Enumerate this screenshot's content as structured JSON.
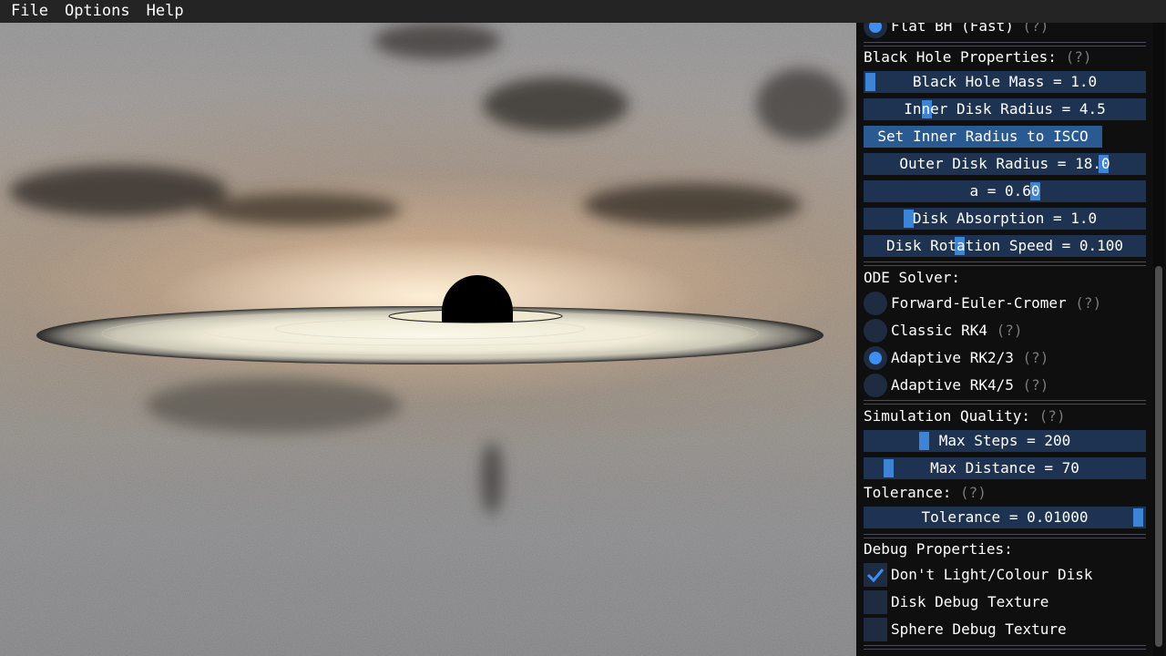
{
  "menu": {
    "file": "File",
    "options": "Options",
    "help": "Help"
  },
  "panel": {
    "flat_bh": {
      "label": "Flat BH (Fast)",
      "help": "(?)",
      "selected": true
    },
    "black_hole": {
      "heading": "Black Hole Properties:",
      "help": "(?)",
      "mass": "Black Hole Mass = 1.0",
      "inner_radius": "Inner Disk Radius = 4.5",
      "set_isco": "Set Inner Radius to ISCO",
      "outer_radius": "Outer Disk Radius = 18.0",
      "spin": "a = 0.60",
      "absorption": "Disk Absorption = 1.0",
      "rotation_speed": "Disk Rotation Speed = 0.100"
    },
    "ode": {
      "heading": "ODE Solver:",
      "options": [
        {
          "label": "Forward-Euler-Cromer",
          "help": "(?)",
          "selected": false
        },
        {
          "label": "Classic RK4",
          "help": "(?)",
          "selected": false
        },
        {
          "label": "Adaptive RK2/3",
          "help": "(?)",
          "selected": true
        },
        {
          "label": "Adaptive RK4/5",
          "help": "(?)",
          "selected": false
        }
      ]
    },
    "quality": {
      "heading": "Simulation Quality:",
      "help": "(?)",
      "max_steps": "Max Steps = 200",
      "max_distance": "Max Distance = 70",
      "tolerance_heading": "Tolerance:",
      "tolerance_help": "(?)",
      "tolerance": "Tolerance = 0.01000"
    },
    "debug": {
      "heading": "Debug Properties:",
      "options": [
        {
          "label": "Don't Light/Colour Disk",
          "checked": true
        },
        {
          "label": "Disk Debug Texture",
          "checked": false
        },
        {
          "label": "Sphere Debug Texture",
          "checked": false
        }
      ]
    }
  },
  "colors": {
    "accent": "#3d84d6",
    "slider_bg": "#1e3352",
    "button_bg": "#2a5a92",
    "panel_bg": "#0f0f0f",
    "menubar_bg": "#242424"
  },
  "icons": {
    "check": "checkmark-icon",
    "radio": "radio-dot-icon"
  }
}
